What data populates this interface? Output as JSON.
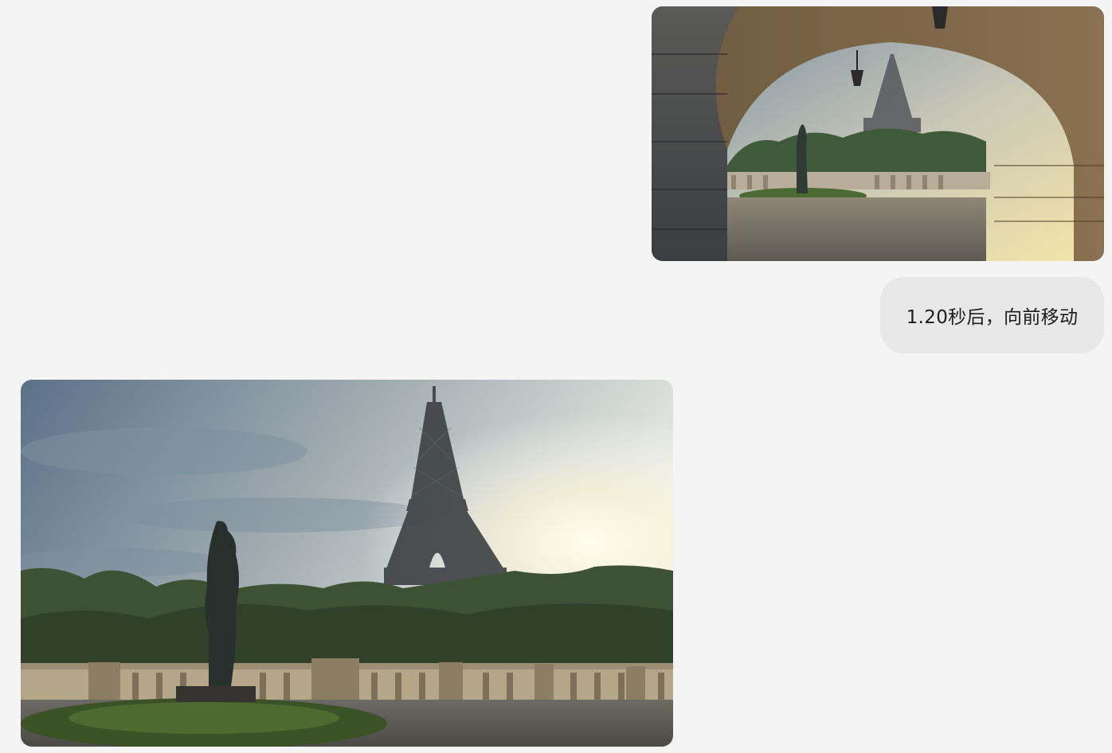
{
  "messages": [
    {
      "role": "user",
      "kind": "image",
      "image": {
        "name": "arch-view-eiffel-tower"
      }
    },
    {
      "role": "user",
      "kind": "text",
      "text": "1.20秒后，向前移动"
    },
    {
      "role": "assistant",
      "kind": "image",
      "image": {
        "name": "forward-view-eiffel-tower"
      }
    }
  ],
  "colors": {
    "background": "#f4f4f4",
    "user_bubble": "#e8e8e8",
    "text": "#1c1c1c"
  }
}
